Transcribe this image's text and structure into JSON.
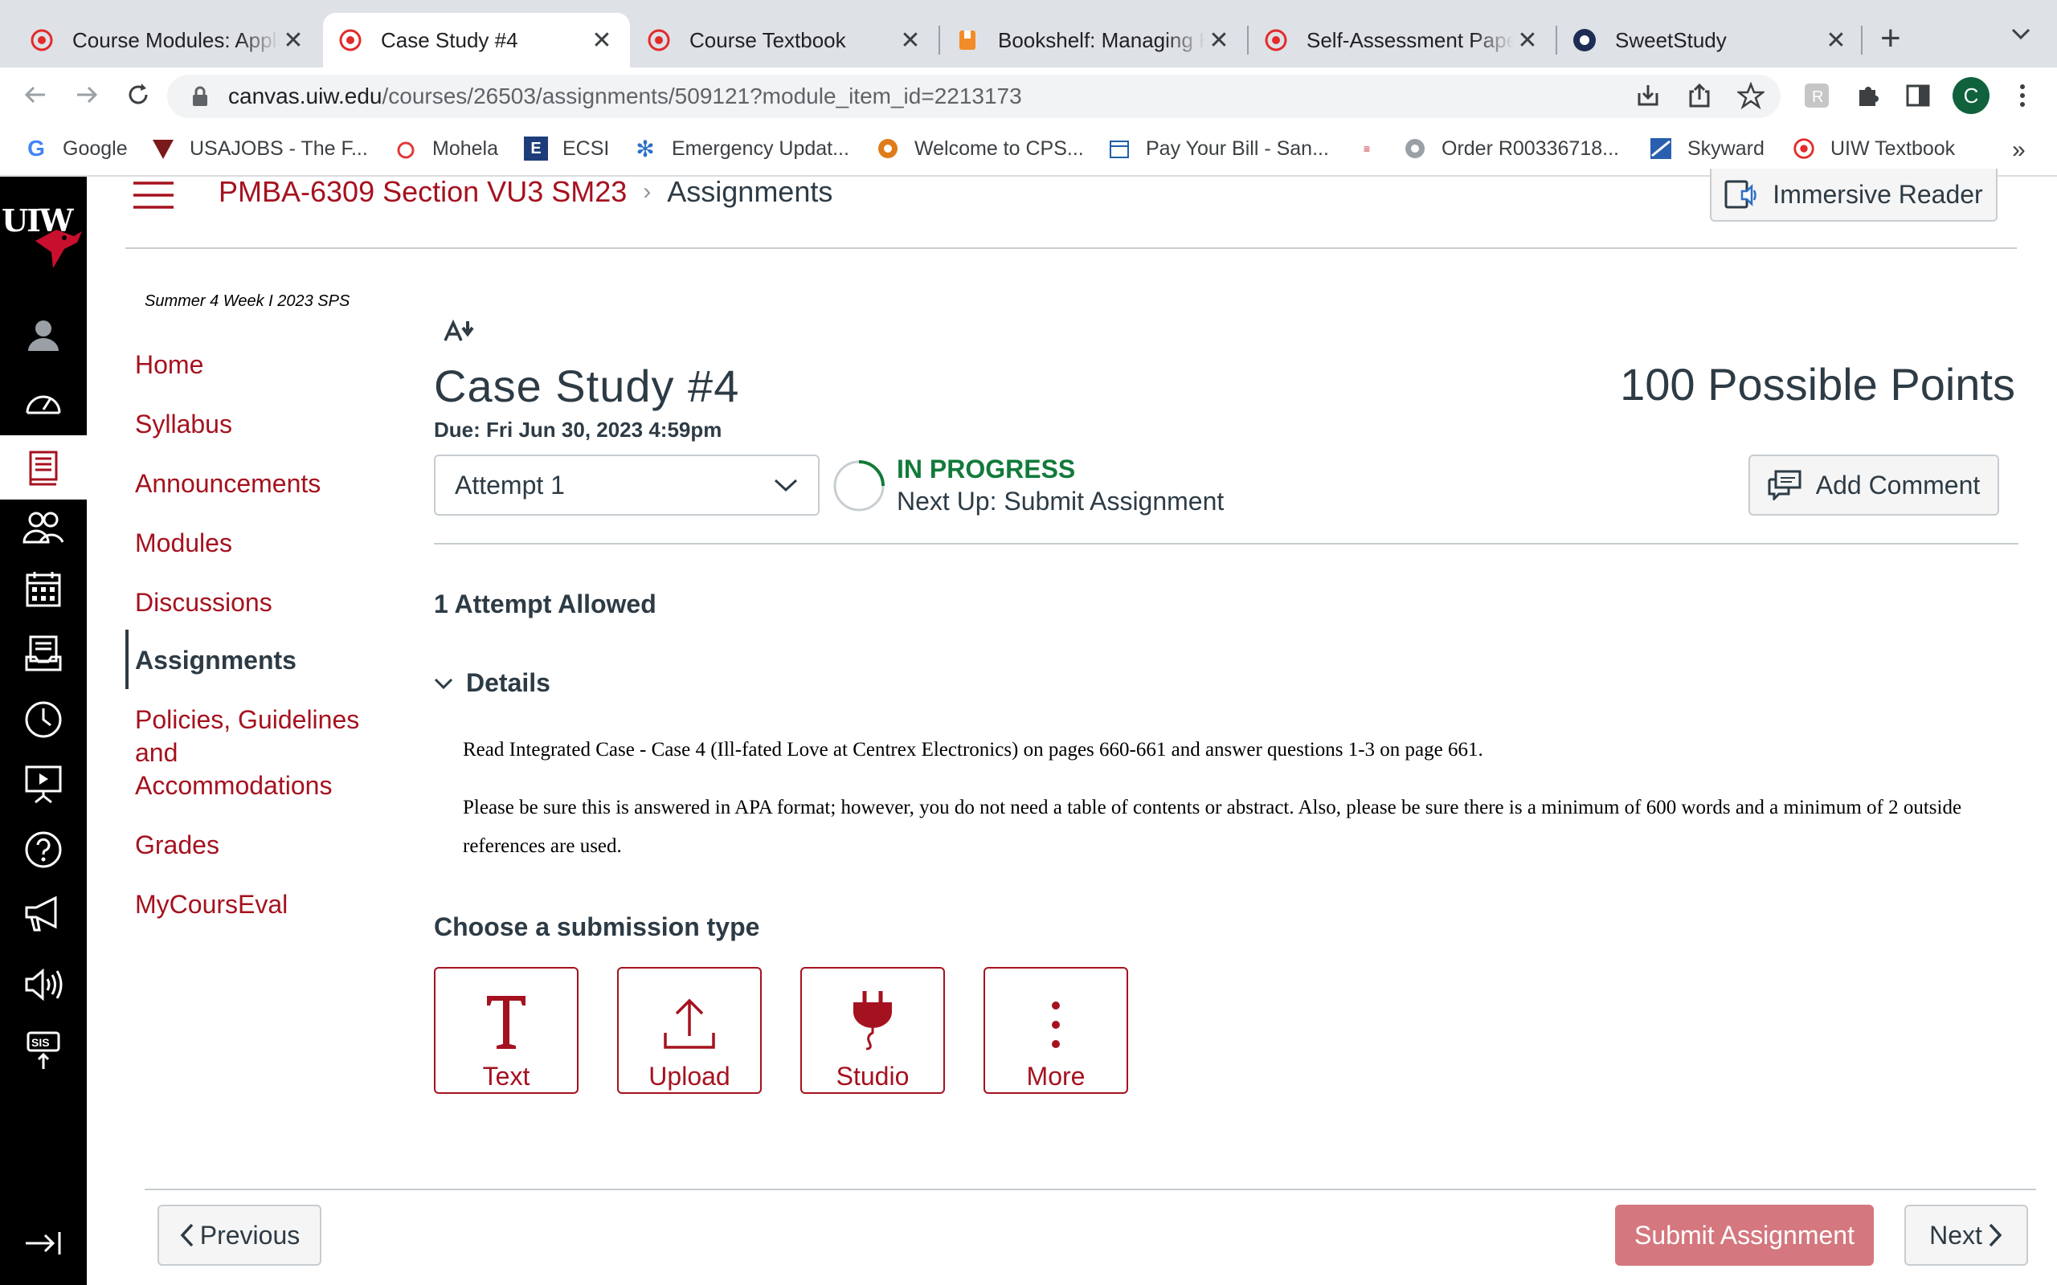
{
  "browser": {
    "tabs": [
      {
        "title": "Course Modules: Applied Business",
        "icon": "canvas-logo-icon",
        "active": false
      },
      {
        "title": "Case Study #4",
        "icon": "canvas-logo-icon",
        "active": true
      },
      {
        "title": "Course Textbook",
        "icon": "canvas-logo-icon",
        "active": false
      },
      {
        "title": "Bookshelf: Managing Human",
        "icon": "bookshelf-icon",
        "active": false
      },
      {
        "title": "Self-Assessment Paper",
        "icon": "canvas-logo-icon",
        "active": false
      },
      {
        "title": "SweetStudy",
        "icon": "sweetstudy-icon",
        "active": false
      }
    ],
    "url_host": "canvas.uiw.edu",
    "url_path": "/courses/26503/assignments/509121?module_item_id=2213173",
    "profile_initial": "C",
    "bookmarks": [
      {
        "label": "Google",
        "icon": "google-icon"
      },
      {
        "label": "USAJOBS - The F...",
        "icon": "usajobs-icon"
      },
      {
        "label": "Mohela",
        "icon": "mohela-icon"
      },
      {
        "label": "ECSI",
        "icon": "ecsi-icon"
      },
      {
        "label": "Emergency Updat...",
        "icon": "emergency-icon"
      },
      {
        "label": "Welcome to CPS...",
        "icon": "cps-icon"
      },
      {
        "label": "Pay Your Bill - San...",
        "icon": "pay-bill-icon"
      },
      {
        "label": "",
        "icon": "cisco-icon"
      },
      {
        "label": "Order R00336718...",
        "icon": "order-icon"
      },
      {
        "label": "Skyward",
        "icon": "skyward-icon"
      },
      {
        "label": "UIW Textbook",
        "icon": "canvas-logo-icon"
      }
    ],
    "bookmarks_more": "»"
  },
  "global_nav": {
    "logo": "UIW",
    "items": [
      "account-icon",
      "dashboard-icon",
      "courses-icon",
      "groups-icon",
      "calendar-icon",
      "inbox-icon",
      "history-icon",
      "studio-icon",
      "help-icon",
      "announcements-icon",
      "readspeaker-icon",
      "sis-icon"
    ],
    "active": "courses-icon",
    "collapse": "collapse-nav-icon"
  },
  "header": {
    "course": "PMBA-6309 Section VU3 SM23",
    "separator": "›",
    "page": "Assignments",
    "immersive_reader": "Immersive Reader"
  },
  "course_nav": {
    "term": "Summer 4 Week I 2023 SPS",
    "items": [
      "Home",
      "Syllabus",
      "Announcements",
      "Modules",
      "Discussions",
      "Assignments",
      "Policies, Guidelines and Accommodations",
      "Grades",
      "MyCoursEval"
    ],
    "active": "Assignments"
  },
  "assignment": {
    "title": "Case Study #4",
    "points": "100 Possible Points",
    "due": "Due: Fri Jun 30, 2023 4:59pm",
    "attempt_select": "Attempt 1",
    "status": "IN PROGRESS",
    "next_up": "Next Up: Submit Assignment",
    "add_comment": "Add Comment",
    "attempts_allowed": "1 Attempt Allowed",
    "details_label": "Details",
    "description": [
      "Read Integrated Case - Case 4 (Ill-fated Love at Centrex Electronics) on pages 660-661 and answer questions 1-3 on page 661.",
      "Please be sure this is answered in APA format; however, you do not need a table of contents or abstract. Also, please be sure there is a minimum of 600 words and a minimum of 2 outside references are used."
    ],
    "submission_heading": "Choose a submission type",
    "submission_types": [
      {
        "label": "Text",
        "icon": "text-icon"
      },
      {
        "label": "Upload",
        "icon": "upload-icon"
      },
      {
        "label": "Studio",
        "icon": "studio-plug-icon"
      },
      {
        "label": "More",
        "icon": "more-vertical-icon"
      }
    ]
  },
  "footer": {
    "previous": "Previous",
    "submit": "Submit Assignment",
    "next": "Next"
  },
  "colors": {
    "brand": "#a5121f",
    "status_green": "#127a3b",
    "submit_disabled": "#d4777e",
    "nav_bg": "#000000"
  }
}
